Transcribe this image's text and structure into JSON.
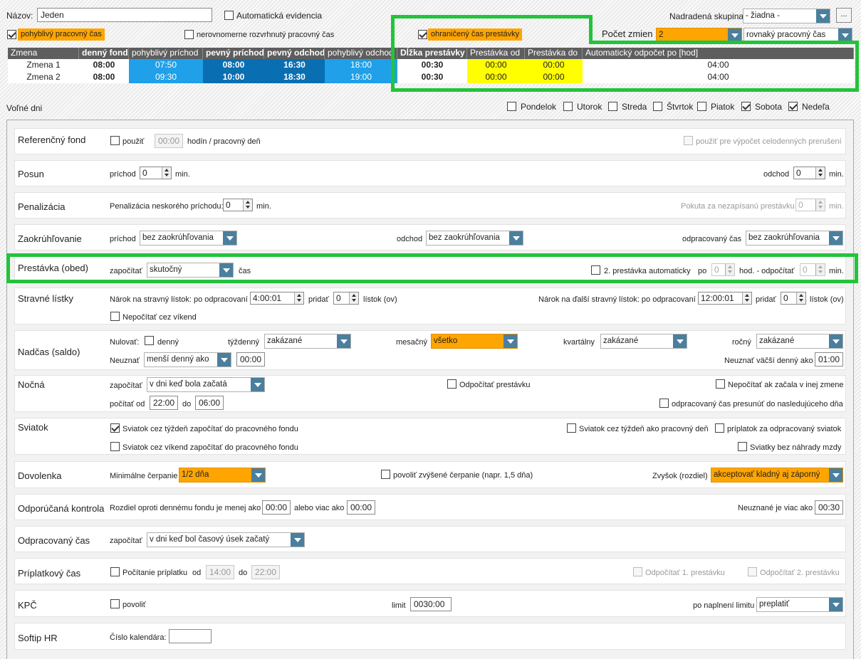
{
  "header": {
    "name_label": "Názov:",
    "name_value": "Jeden",
    "auto_evid": "Automatická evidencia",
    "parent_label": "Nadradená skupina:",
    "parent_value": "- žiadna -",
    "ellipsis": "...",
    "flex_time": "pohyblivý pracovný čas",
    "uneven": "nerovnomerne rozvrhnutý pracovný čas",
    "limited_break": "ohraničený čas prestávky",
    "shift_count_label": "Počet zmien",
    "shift_count_value": "2",
    "shift_type_value": "rovnaký pracovný čas"
  },
  "shift_table": {
    "headers": [
      "Zmena",
      "denný fond",
      "pohyblivý príchod",
      "pevný príchod",
      "pevný odchod",
      "pohyblivý odchod",
      "Dĺžka prestávky",
      "Prestávka od",
      "Prestávka do",
      "Automatický odpočet po [hod]"
    ],
    "rows": [
      [
        "Zmena 1",
        "08:00",
        "07:50",
        "08:00",
        "16:30",
        "18:00",
        "00:30",
        "00:00",
        "00:00",
        "04:00"
      ],
      [
        "Zmena 2",
        "08:00",
        "09:30",
        "10:00",
        "18:30",
        "19:00",
        "00:30",
        "00:00",
        "00:00",
        "04:00"
      ]
    ]
  },
  "free_days": {
    "label": "Voľné dni",
    "days": [
      {
        "name": "Pondelok",
        "checked": false
      },
      {
        "name": "Utorok",
        "checked": false
      },
      {
        "name": "Streda",
        "checked": false
      },
      {
        "name": "Štvrtok",
        "checked": false
      },
      {
        "name": "Piatok",
        "checked": false
      },
      {
        "name": "Sobota",
        "checked": true
      },
      {
        "name": "Nedeľa",
        "checked": true
      }
    ]
  },
  "sections": {
    "ref": {
      "title": "Referenčný fond",
      "use": "použiť",
      "hours": "00:00",
      "unit": "hodín / pracovný deň",
      "right": "použiť pre výpočet celodenných prerušení"
    },
    "posun": {
      "title": "Posun",
      "arr": "príchod",
      "arr_val": "0",
      "min": "min.",
      "dep": "odchod",
      "dep_val": "0",
      "min2": "min."
    },
    "pen": {
      "title": "Penalizácia",
      "label": "Penalizácia neskorého príchodu:",
      "val": "0",
      "min": "min.",
      "right": "Pokuta za nezapísanú prestávku",
      "right_val": "0",
      "min2": "min."
    },
    "round": {
      "title": "Zaokrúhľovanie",
      "arr": "príchod",
      "arr_val": "bez zaokrúhľovania",
      "dep": "odchod",
      "dep_val": "bez zaokrúhľovania",
      "work": "odpracovaný čas",
      "work_val": "bez zaokrúhľovania"
    },
    "break": {
      "title": "Prestávka (obed)",
      "count": "započítať",
      "count_val": "skutočný",
      "time": "čas",
      "second": "2. prestávka automaticky",
      "after": "po",
      "after_val": "0",
      "hours": "hod. - odpočítať",
      "sub_val": "0",
      "min": "min."
    },
    "meal": {
      "title": "Stravné lístky",
      "claim": "Nárok na stravný lístok: po odpracovaní",
      "claim_val": "4:00:01",
      "add": "pridať",
      "add_val": "0",
      "tickets": "lístok (ov)",
      "claim2": "Nárok na ďalší stravný lístok: po odpracovaní",
      "claim2_val": "12:00:01",
      "add2": "pridať",
      "add2_val": "0",
      "tickets2": "lístok (ov)",
      "weekend": "Nepočítať cez víkend"
    },
    "over": {
      "title": "Nadčas (saldo)",
      "reset": "Nulovať:",
      "daily": "denný",
      "weekly": "týždenný",
      "weekly_val": "zakázané",
      "monthly": "mesačný",
      "monthly_val": "všetko",
      "quarterly": "kvartálny",
      "quarterly_val": "zakázané",
      "yearly": "ročný",
      "yearly_val": "zakázané",
      "ignore": "Neuznať",
      "ignore_val": "menší denný ako",
      "ignore_time": "00:00",
      "ignore2": "Neuznať väčší denný ako",
      "ignore2_time": "01:00"
    },
    "night": {
      "title": "Nočná",
      "count": "započítať",
      "count_val": "v dni keď bola začatá",
      "sub_break": "Odpočítať prestávku",
      "no_other": "Nepočítať ak začala v inej zmene",
      "from": "počítať od",
      "from_val": "22:00",
      "to": "do",
      "to_val": "06:00",
      "move": "odpracovaný čas presunúť do nasledujúceho dňa"
    },
    "holiday": {
      "title": "Sviatok",
      "h1": "Sviatok cez týždeň započítať do pracovného fondu",
      "h2": "Sviatok cez týždeň ako pracovný deň",
      "h3": "príplatok za odpracovaný sviatok",
      "h4": "Sviatok cez víkend započítať do pracovného fondu",
      "h5": "Sviatky bez náhrady mzdy"
    },
    "vac": {
      "title": "Dovolenka",
      "min": "Minimálne čerpanie",
      "min_val": "1/2 dňa",
      "allow": "povoliť zvýšené čerpanie (napr. 1,5 dňa)",
      "rest": "Zvyšok (rozdiel)",
      "rest_val": "akceptovať kladný aj záporný"
    },
    "check": {
      "title": "Odporúčaná kontrola",
      "diff": "Rozdiel oproti dennému fondu je menej ako",
      "v1": "00:00",
      "or": "alebo viac ako",
      "v2": "00:00",
      "right": "Neuznané je viac ako",
      "v3": "00:30"
    },
    "worked": {
      "title": "Odpracovaný čas",
      "count": "započítať",
      "count_val": "v dni keď bol časový úsek  začatý"
    },
    "bonus": {
      "title": "Príplatkový čas",
      "calc": "Počítanie príplatku",
      "from": "od",
      "from_val": "14:00",
      "to": "do",
      "to_val": "22:00",
      "b1": "Odpočítať 1. prestávku",
      "b2": "Odpočítať 2. prestávku"
    },
    "kpc": {
      "title": "KPČ",
      "allow": "povoliť",
      "limit": "limit",
      "limit_val": "0030:00",
      "after": "po naplnení limitu",
      "after_val": "preplatiť"
    },
    "softip": {
      "title": "Softip HR",
      "cal": "Číslo kalendára:",
      "cal_val": ""
    }
  }
}
